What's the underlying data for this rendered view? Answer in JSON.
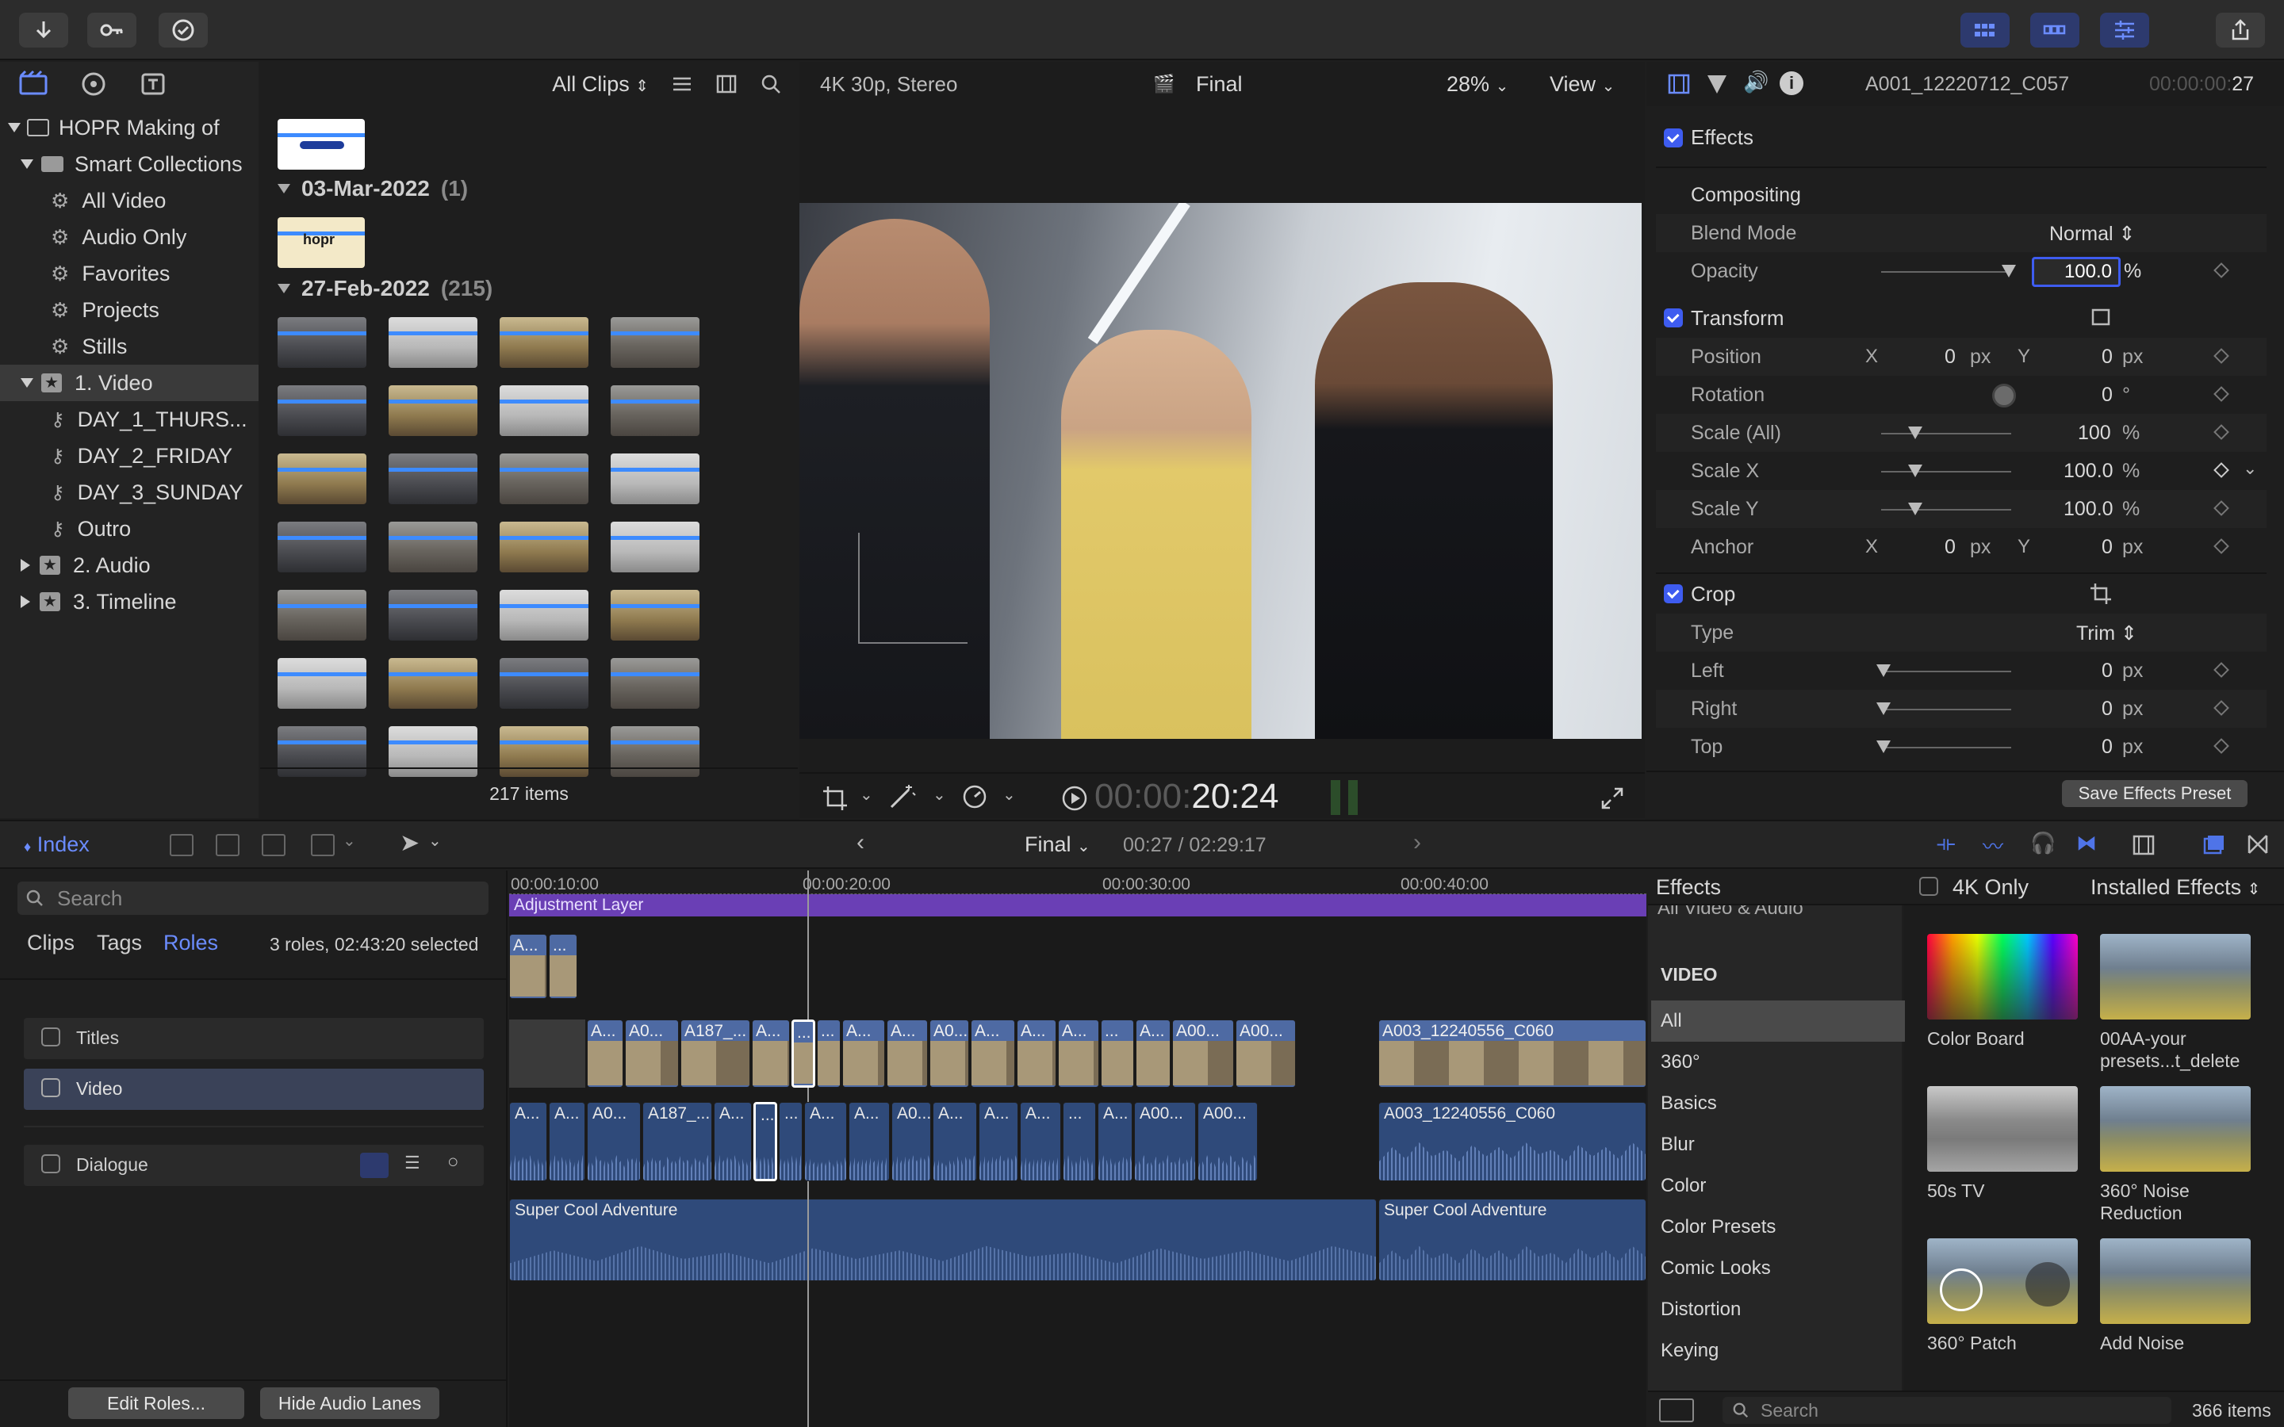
{
  "toolbar": {},
  "browser": {
    "library": "HOPR Making of",
    "smart_collections": "Smart Collections",
    "items": [
      "All Video",
      "Audio Only",
      "Favorites",
      "Projects",
      "Stills"
    ],
    "event_video": "1. Video",
    "keywords": [
      "DAY_1_THURS...",
      "DAY_2_FRIDAY",
      "DAY_3_SUNDAY",
      "Outro"
    ],
    "event_audio": "2. Audio",
    "event_timeline": "3. Timeline",
    "filter": "All Clips",
    "group1_date": "03-Mar-2022",
    "group1_count": "(1)",
    "group2_date": "27-Feb-2022",
    "group2_count": "(215)",
    "item_count": "217 items",
    "thumb_logo": "hopr"
  },
  "viewer": {
    "format": "4K 30p, Stereo",
    "project": "Final",
    "zoom": "28%",
    "view": "View",
    "timecode_dim": "00:00:",
    "timecode_bright": "20:24"
  },
  "inspector": {
    "clip_name": "A001_12220712_C057",
    "timecode_dim": "00:00:00:",
    "timecode_bright": "27",
    "effects": "Effects",
    "compositing": "Compositing",
    "blend_mode_label": "Blend Mode",
    "blend_mode_value": "Normal",
    "opacity_label": "Opacity",
    "opacity_value": "100.0",
    "pct": "%",
    "transform": "Transform",
    "position_label": "Position",
    "x": "X",
    "y": "Y",
    "px": "px",
    "zero": "0",
    "rotation_label": "Rotation",
    "degree": "°",
    "scale_all_label": "Scale (All)",
    "scale_all_value": "100",
    "scale_x_label": "Scale X",
    "scale_x_value": "100.0",
    "scale_y_label": "Scale Y",
    "scale_y_value": "100.0",
    "anchor_label": "Anchor",
    "crop": "Crop",
    "type_label": "Type",
    "type_value": "Trim",
    "left_label": "Left",
    "right_label": "Right",
    "top_label": "Top",
    "save_preset": "Save Effects Preset"
  },
  "timeline_index": {
    "index": "Index",
    "search_placeholder": "Search",
    "tabs": [
      "Clips",
      "Tags",
      "Roles"
    ],
    "summary": "3 roles, 02:43:20 selected",
    "roles": [
      "Titles",
      "Video",
      "Dialogue"
    ],
    "edit_roles": "Edit Roles...",
    "hide_audio": "Hide Audio Lanes"
  },
  "timeline": {
    "project": "Final",
    "position": "00:27 / 02:29:17",
    "ruler": [
      "00:00:10:00",
      "00:00:20:00",
      "00:00:30:00",
      "00:00:40:00"
    ],
    "adjustment_layer": "Adjustment Layer",
    "small_clips": [
      "A...",
      "..."
    ],
    "video_clips": [
      "A...",
      "A0...",
      "A187_...",
      "A...",
      "...",
      "...",
      "A...",
      "A...",
      "A0...",
      "A...",
      "A...",
      "A...",
      "...",
      "A...",
      "A00...",
      "A00..."
    ],
    "main_clip": "A003_12240556_C060",
    "audio_clips": [
      "A...",
      "A...",
      "A0...",
      "A187_...",
      "A...",
      "...",
      "...",
      "A...",
      "A...",
      "A0...",
      "A...",
      "A...",
      "A...",
      "...",
      "A...",
      "A00...",
      "A00..."
    ],
    "music": "Super Cool Adventure"
  },
  "effects_browser": {
    "title": "Effects",
    "filter_4k": "4K Only",
    "installed": "Installed Effects",
    "cut_label": "All Video & Audio",
    "section": "VIDEO",
    "categories": [
      "All",
      "360°",
      "Basics",
      "Blur",
      "Color",
      "Color Presets",
      "Comic Looks",
      "Distortion",
      "Keying"
    ],
    "effects": [
      "Color Board",
      "00AA-your presets...t_delete",
      "50s TV",
      "360° Noise Reduction",
      "360° Patch",
      "Add Noise"
    ],
    "search_placeholder": "Search",
    "count": "366 items"
  },
  "colors": {
    "accent": "#3e5cf0",
    "clip_video": "#4e6aa3",
    "clip_audio": "#2f4a7a",
    "adjustment": "#6a3fb5"
  }
}
